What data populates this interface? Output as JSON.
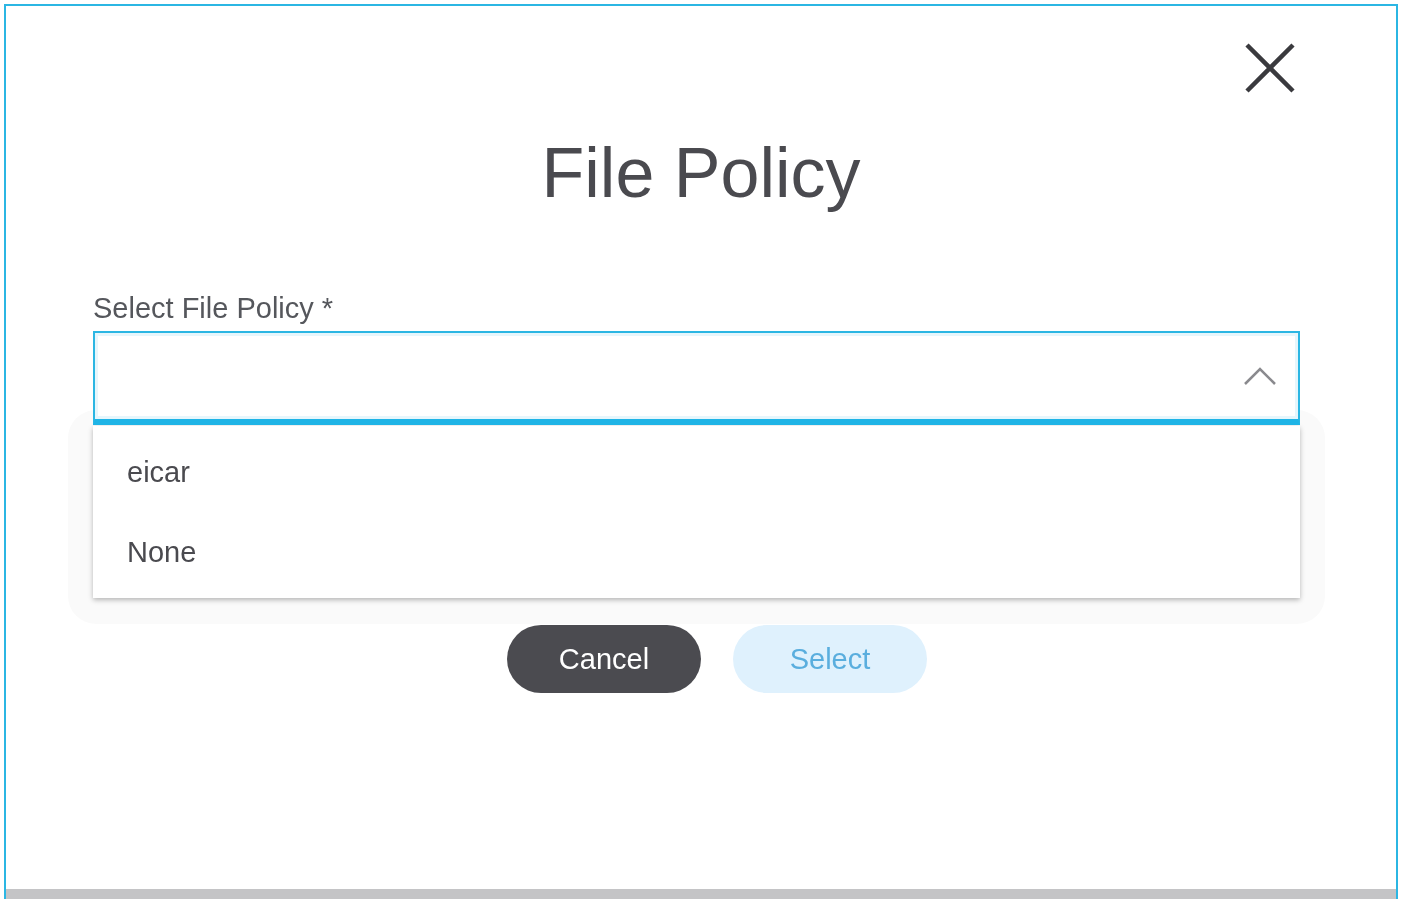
{
  "dialog": {
    "title": "File Policy"
  },
  "field": {
    "label": "Select File Policy *",
    "expanded": true,
    "options": [
      {
        "label": "eicar",
        "selected": false
      },
      {
        "label": "None",
        "selected": false
      }
    ]
  },
  "buttons": [
    {
      "label": "Cancel",
      "kind": "secondary",
      "disabled": false
    },
    {
      "label": "Select",
      "kind": "primary",
      "disabled": true
    }
  ]
}
